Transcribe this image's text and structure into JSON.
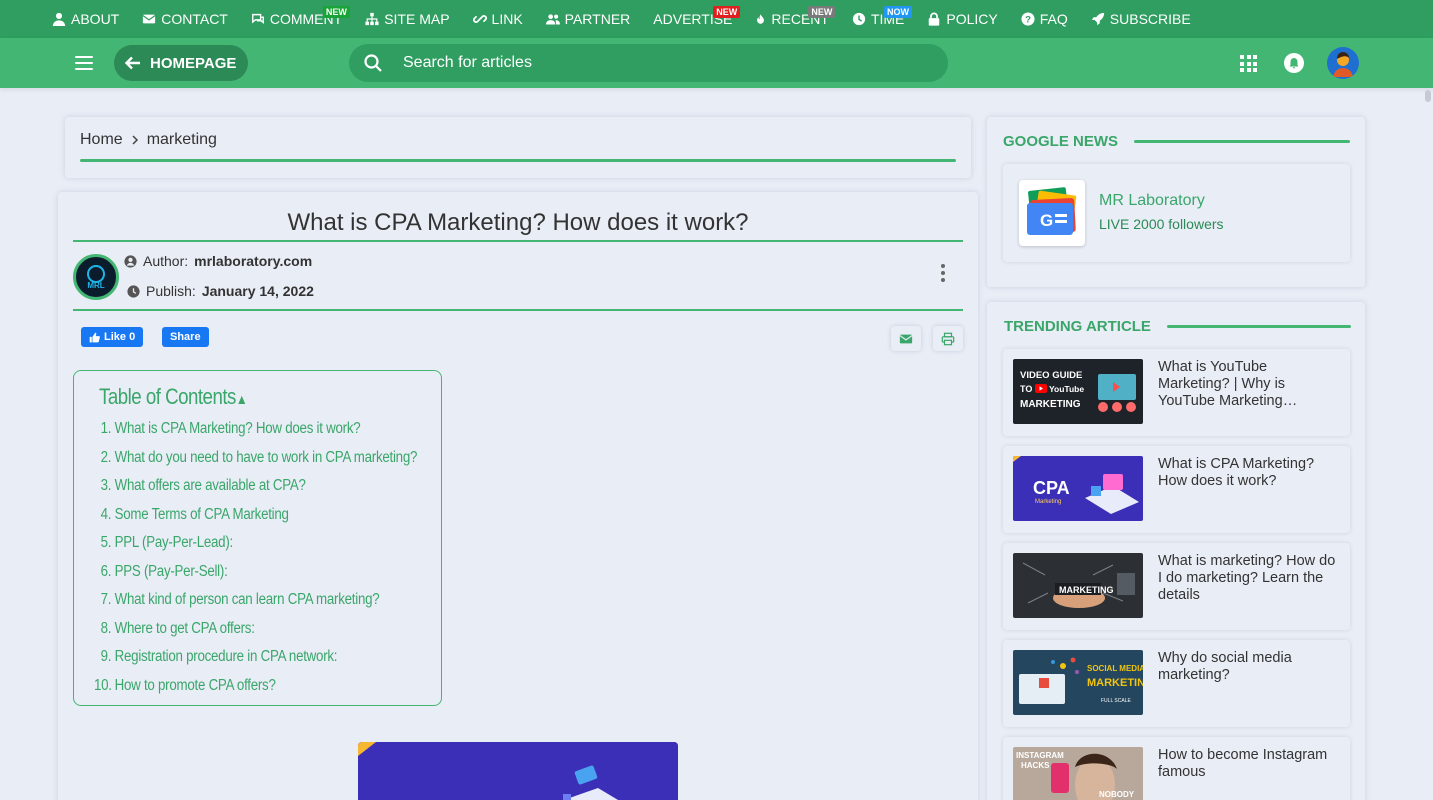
{
  "topnav": [
    {
      "label": "ABOUT",
      "icon": "user-icon",
      "badge": ""
    },
    {
      "label": "CONTACT",
      "icon": "envelope-icon",
      "badge": ""
    },
    {
      "label": "COMMENT",
      "icon": "comments-icon",
      "badge": "NEW",
      "badge_color": "#1aa336"
    },
    {
      "label": "SITE MAP",
      "icon": "sitemap-icon",
      "badge": ""
    },
    {
      "label": "LINK",
      "icon": "link-icon",
      "badge": ""
    },
    {
      "label": "PARTNER",
      "icon": "users-icon",
      "badge": ""
    },
    {
      "label": "ADVERTISE",
      "icon": "",
      "badge": "NEW",
      "badge_color": "#e02020"
    },
    {
      "label": "RECENT",
      "icon": "fire-icon",
      "badge": "NEW",
      "badge_color": "#7a7a7a"
    },
    {
      "label": "TIME",
      "icon": "clock-icon",
      "badge": "NOW",
      "badge_color": "#2196f3"
    },
    {
      "label": "POLICY",
      "icon": "lock-icon",
      "badge": ""
    },
    {
      "label": "FAQ",
      "icon": "question-icon",
      "badge": ""
    },
    {
      "label": "SUBSCRIBE",
      "icon": "rocket-icon",
      "badge": ""
    }
  ],
  "header": {
    "home_label": "HOMEPAGE",
    "search_placeholder": "Search for articles"
  },
  "breadcrumb": {
    "home": "Home",
    "current": "marketing"
  },
  "article": {
    "title": "What is CPA Marketing? How does it work?",
    "author_label": "Author:",
    "author": "mrlaboratory.com",
    "publish_label": "Publish:",
    "publish_date": "January 14, 2022",
    "fb_like": "Like 0",
    "fb_share": "Share"
  },
  "toc": {
    "title": "Table of Contents",
    "items": [
      {
        "num": "1.",
        "label": "What is CPA Marketing? How does it work?"
      },
      {
        "num": "2.",
        "label": "What do you need to have to work in CPA marketing?"
      },
      {
        "num": "3.",
        "label": "What offers are available at CPA?"
      },
      {
        "num": "4.",
        "label": "Some Terms of CPA Marketing"
      },
      {
        "num": "5.",
        "label": "PPL (Pay-Per-Lead):"
      },
      {
        "num": "6.",
        "label": "PPS (Pay-Per-Sell):"
      },
      {
        "num": "7.",
        "label": "What kind of person can learn CPA marketing?"
      },
      {
        "num": "8.",
        "label": "Where to get CPA offers:"
      },
      {
        "num": "9.",
        "label": "Registration procedure in CPA network:"
      },
      {
        "num": "10.",
        "label": "How to promote CPA offers?"
      }
    ]
  },
  "google_news": {
    "heading": "GOOGLE NEWS",
    "name": "MR Laboratory",
    "followers": "LIVE 2000 followers"
  },
  "trending": {
    "heading": "TRENDING ARTICLE",
    "items": [
      {
        "title": "What is YouTube Marketing? | Why is YouTube Marketing important?",
        "thumb_text": "VIDEO GUIDE TO YouTube MARKETING"
      },
      {
        "title": "What is CPA Marketing? How does it work?",
        "thumb_text": "CPA"
      },
      {
        "title": "What is marketing? How do I do marketing? Learn the details",
        "thumb_text": "MARKETING"
      },
      {
        "title": "Why do social media marketing?",
        "thumb_text": "SOCIAL MEDIA MARKETING"
      },
      {
        "title": "How to become Instagram famous",
        "thumb_text": "INSTAGRAM HACKS"
      }
    ]
  },
  "colors": {
    "topbar": "#2f9e60",
    "header": "#44b673",
    "accent": "#3aa66a",
    "background": "#e9edf6"
  }
}
